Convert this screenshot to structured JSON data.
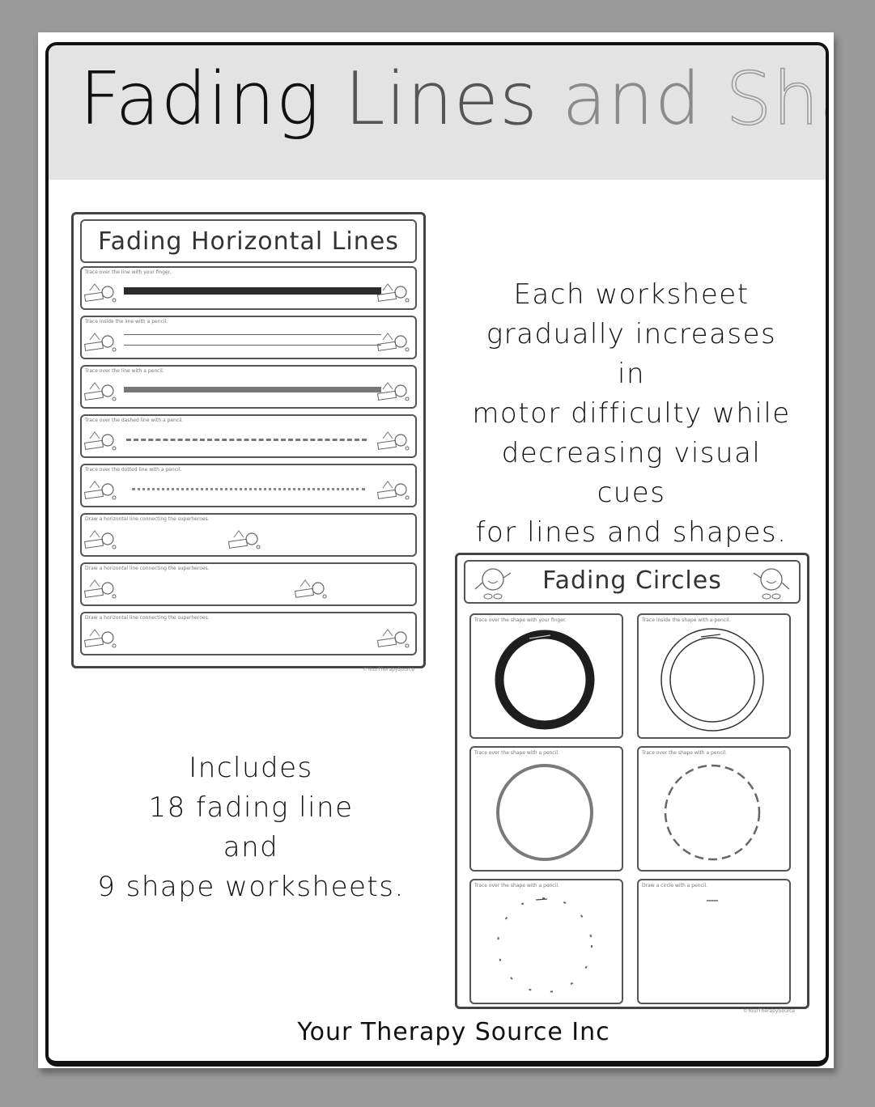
{
  "header": {
    "title_words": [
      "Fading",
      "Lines",
      "and",
      "Shapes"
    ]
  },
  "worksheet_lines": {
    "title": "Fading Horizontal Lines",
    "rows": [
      {
        "instruction": "Trace over the line with your finger.",
        "style": "solid-black"
      },
      {
        "instruction": "Trace inside the line with a pencil.",
        "style": "outline"
      },
      {
        "instruction": "Trace over the line with a pencil.",
        "style": "solid-gray"
      },
      {
        "instruction": "Trace over the dashed line with a pencil.",
        "style": "dashed"
      },
      {
        "instruction": "Trace over the dotted line with a pencil.",
        "style": "dotted"
      },
      {
        "instruction": "Draw a horizontal line connecting the superheroes.",
        "style": "gap-short"
      },
      {
        "instruction": "Draw a horizontal line connecting the superheroes.",
        "style": "gap-medium"
      },
      {
        "instruction": "Draw a horizontal line connecting the superheroes.",
        "style": "gap-long"
      }
    ],
    "copyright": "©YourTherapySource"
  },
  "worksheet_circles": {
    "title": "Fading Circles",
    "cells": [
      {
        "instruction": "Trace over the shape with your finger.",
        "style": "thick-black"
      },
      {
        "instruction": "Trace inside the shape with a pencil.",
        "style": "double-outline"
      },
      {
        "instruction": "Trace over the shape with a pencil.",
        "style": "gray"
      },
      {
        "instruction": "Trace over the shape with a pencil.",
        "style": "dashed"
      },
      {
        "instruction": "Trace over the shape with a pencil.",
        "style": "sparse-dashes"
      },
      {
        "instruction": "Draw a circle with a pencil.",
        "style": "empty"
      }
    ],
    "copyright": "©YourTherapySource"
  },
  "description": {
    "lines": [
      "Each worksheet",
      "gradually increases in",
      "motor difficulty while",
      "decreasing visual cues",
      "for lines and shapes."
    ]
  },
  "includes": {
    "lines": [
      "Includes",
      "18 fading line",
      "and",
      "9 shape worksheets."
    ]
  },
  "footer": {
    "brand": "Your Therapy Source Inc"
  }
}
